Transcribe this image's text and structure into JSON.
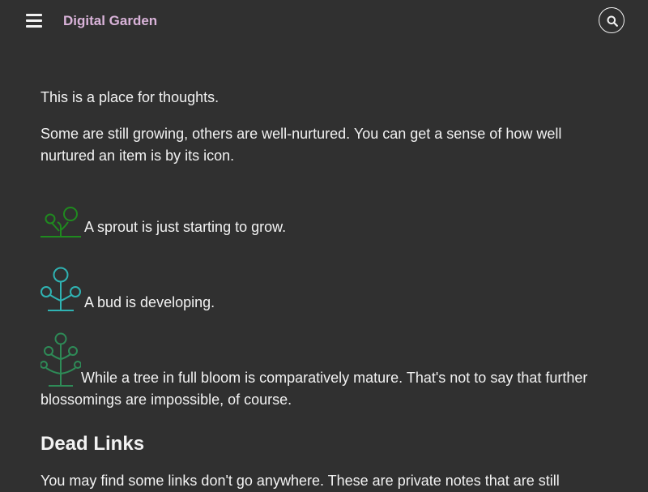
{
  "header": {
    "site_title": "Digital Garden",
    "menu_icon": "hamburger-icon",
    "search_icon": "search-icon"
  },
  "main": {
    "intro": "This is a place for thoughts.",
    "description": "Some are still growing, others are well-nurtured. You can get a sense of how well nurtured an item is by its icon.",
    "stages": [
      {
        "icon": "sprout-icon",
        "text": "A sprout is just starting to grow.",
        "color": "#1f8a1f"
      },
      {
        "icon": "bud-icon",
        "text": "A bud is developing.",
        "color": "#2fb3b3"
      },
      {
        "icon": "tree-icon",
        "text": "While a tree in full bloom is comparatively mature. That's not to say that further blossomings are impossible, of course.",
        "color": "#2e8b57"
      }
    ],
    "dead_links_heading": "Dead Links",
    "dead_links_text": "You may find some links don't go anywhere. These are private notes that are still"
  },
  "colors": {
    "background": "#303030",
    "text": "#f2f2f2",
    "title": "#d9b3d9"
  }
}
